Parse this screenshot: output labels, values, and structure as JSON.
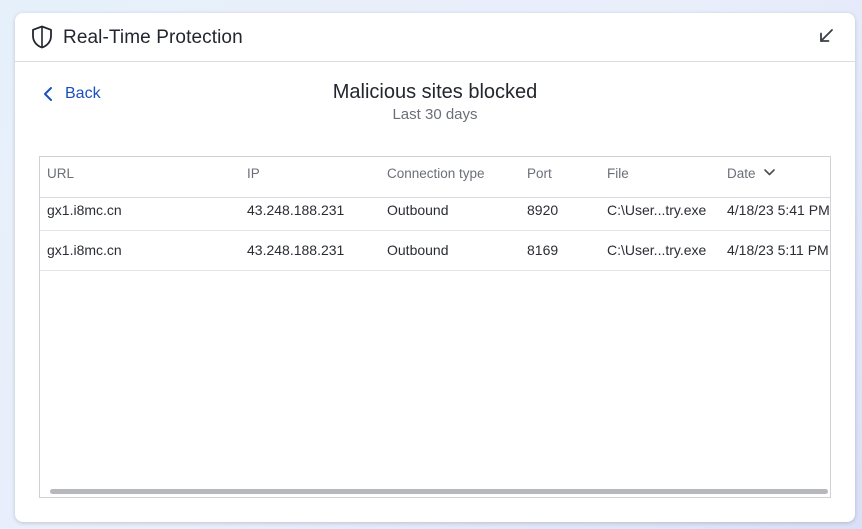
{
  "window": {
    "title": "Real-Time Protection"
  },
  "nav": {
    "back_label": "Back"
  },
  "page": {
    "title": "Malicious sites blocked",
    "subtitle": "Last 30 days"
  },
  "table": {
    "columns": [
      "URL",
      "IP",
      "Connection type",
      "Port",
      "File",
      "Date"
    ],
    "rows": [
      [
        "gx1.i8mc.cn",
        "43.248.188.231",
        "Outbound",
        "8920",
        "C:\\User...try.exe",
        "4/18/23 5:41 PM"
      ],
      [
        "gx1.i8mc.cn",
        "43.248.188.231",
        "Outbound",
        "8169",
        "C:\\User...try.exe",
        "4/18/23 5:11 PM"
      ]
    ],
    "sort_column": "Date",
    "sort_direction": "descending"
  },
  "colors": {
    "accent": "#1a4fc4",
    "text": "#22262e",
    "muted": "#6b6f78"
  },
  "icons": {
    "title": "shield-icon",
    "minimize": "minimize-arrow-icon",
    "back": "chevron-left-icon",
    "sort": "chevron-down-icon"
  }
}
